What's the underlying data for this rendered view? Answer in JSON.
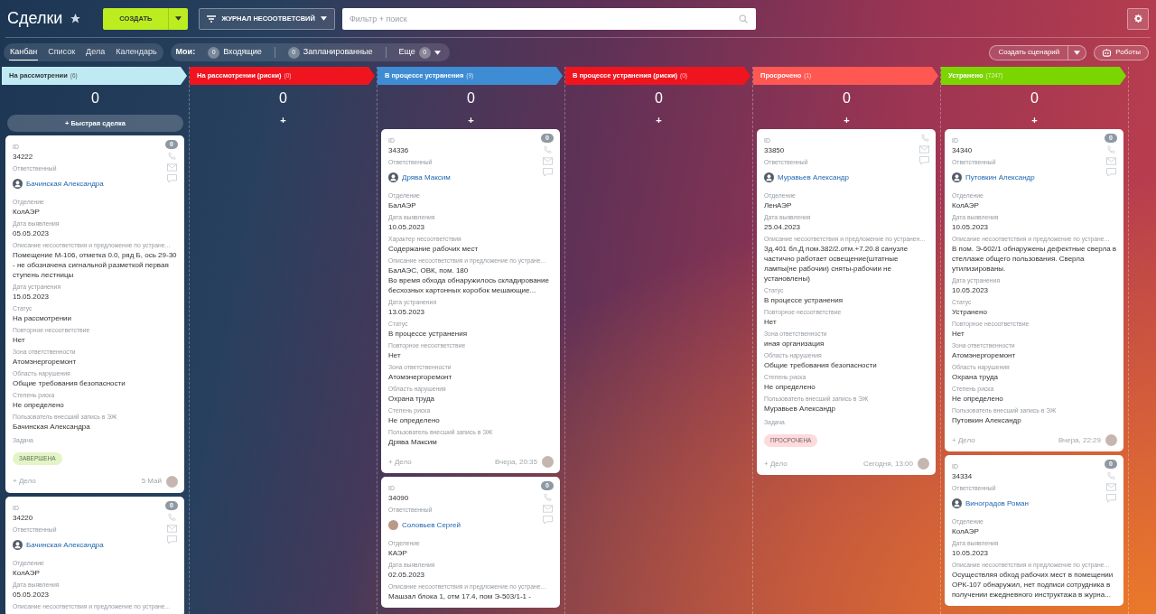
{
  "header": {
    "title": "Сделки",
    "create_button": "СОЗДАТЬ",
    "journal_button": "ЖУРНАЛ НЕСООТВЕТСВИЙ",
    "search": {
      "placeholder": "Фильтр + поиск"
    }
  },
  "view_tabs": [
    {
      "label": "Канбан",
      "selected": true
    },
    {
      "label": "Список",
      "selected": false
    },
    {
      "label": "Дела",
      "selected": false
    },
    {
      "label": "Календарь",
      "selected": false
    }
  ],
  "my_counters": {
    "label": "Мои:",
    "items": [
      {
        "label": "Входящие",
        "count": "0"
      },
      {
        "label": "Запланированные",
        "count": "0"
      }
    ],
    "more": {
      "label": "Еще",
      "count": "0"
    }
  },
  "scenario_button": "Создать сценарий",
  "robots_button": "Роботы",
  "columns": [
    {
      "name": "На рассмотрении",
      "count": "(6)",
      "color": "#bfeaf3",
      "total": "0",
      "add": {
        "icon": "+",
        "label": "Быстрая сделка"
      },
      "cards": [
        {
          "counter": "0",
          "fields": [
            {
              "kind": "text",
              "label": "ID",
              "value": "34222"
            },
            {
              "kind": "user",
              "label": "Ответственный",
              "value": "Бачинская Александра",
              "avatar": {
                "kind": "icon"
              }
            },
            {
              "kind": "text",
              "label": "Отделение",
              "value": "КолАЭР"
            },
            {
              "kind": "text",
              "label": "Дата выявления",
              "value": "05.05.2023"
            },
            {
              "kind": "text",
              "label": "Описание несоответствия и предложение по устране...",
              "value": "Помещение М-106, отметка 0.0, ряд Б, ось 29-30 - не обозначена сигнальной разметкой первая ступень лестницы"
            },
            {
              "kind": "text",
              "label": "Дата устранения",
              "value": "15.05.2023"
            },
            {
              "kind": "text",
              "label": "Статус",
              "value": "На рассмотрении"
            },
            {
              "kind": "text",
              "label": "Повторное несоответствие",
              "value": "Нет"
            },
            {
              "kind": "text",
              "label": "Зона ответственности",
              "value": "Атомэнергоремонт"
            },
            {
              "kind": "text",
              "label": "Область нарушения",
              "value": "Общие требования безопасности"
            },
            {
              "kind": "text",
              "label": "Степень риска",
              "value": "Не определено"
            },
            {
              "kind": "text",
              "label": "Пользователь внесший запись в ЭЖ",
              "value": "Бачинская Александра"
            },
            {
              "kind": "badge",
              "label": "Задача",
              "value": "ЗАВЕРШЕНА",
              "color": "#e3f5c7"
            }
          ],
          "footer": {
            "add": "+ Дело",
            "date": "5 Май"
          }
        },
        {
          "counter": "0",
          "fields": [
            {
              "kind": "text",
              "label": "ID",
              "value": "34220"
            },
            {
              "kind": "user",
              "label": "Ответственный",
              "value": "Бачинская Александра",
              "avatar": {
                "kind": "icon"
              }
            },
            {
              "kind": "text",
              "label": "Отделение",
              "value": "КолАЭР"
            },
            {
              "kind": "text",
              "label": "Дата выявления",
              "value": "05.05.2023"
            },
            {
              "kind": "text",
              "label": "Описание несоответствия и предложение по устране..."
            }
          ]
        }
      ]
    },
    {
      "name": "На рассмотрении (риски)",
      "count": "(0)",
      "color": "#f0141e",
      "total": "0",
      "add": {
        "icon": "+"
      }
    },
    {
      "name": "В процессе устранения",
      "count": "(9)",
      "color": "#3e8cd3",
      "total": "0",
      "add": {
        "icon": "+"
      },
      "cards": [
        {
          "counter": "0",
          "fields": [
            {
              "kind": "text",
              "label": "ID",
              "value": "34336"
            },
            {
              "kind": "user",
              "label": "Ответственный",
              "value": "Дрява Максим",
              "avatar": {
                "kind": "icon"
              }
            },
            {
              "kind": "text",
              "label": "Отделение",
              "value": "БалАЭР"
            },
            {
              "kind": "text",
              "label": "Дата выявления",
              "value": "10.05.2023"
            },
            {
              "kind": "text",
              "label": "Характер несоответствия",
              "value": "Содержание рабочих мест"
            },
            {
              "kind": "text",
              "label": "Описание несоответствия и предложение по устране...",
              "value": "БалАЭС, ОВК, пом. 180\nВо время обхода обнаружилось складирование бесхозных картонных коробок мешающие..."
            },
            {
              "kind": "text",
              "label": "Дата устранения",
              "value": "13.05.2023"
            },
            {
              "kind": "text",
              "label": "Статус",
              "value": "В процессе устранения"
            },
            {
              "kind": "text",
              "label": "Повторное несоответствие",
              "value": "Нет"
            },
            {
              "kind": "text",
              "label": "Зона ответственности",
              "value": "Атомэнергоремонт"
            },
            {
              "kind": "text",
              "label": "Область нарушения",
              "value": "Охрана труда"
            },
            {
              "kind": "text",
              "label": "Степень риска",
              "value": "Не определено"
            },
            {
              "kind": "text",
              "label": "Пользователь внесший запись в ЭЖ",
              "value": "Дрява Максим"
            }
          ],
          "footer": {
            "add": "+ Дело",
            "date": "Вчера, 20:35"
          }
        },
        {
          "counter": "0",
          "fields": [
            {
              "kind": "text",
              "label": "ID",
              "value": "34090"
            },
            {
              "kind": "user",
              "label": "Ответственный",
              "value": "Соловьев Сергей",
              "avatar": {
                "kind": "photo"
              }
            },
            {
              "kind": "text",
              "label": "Отделение",
              "value": "КАЭР"
            },
            {
              "kind": "text",
              "label": "Дата выявления",
              "value": "02.05.2023"
            },
            {
              "kind": "text",
              "label": "Описание несоответствия и предложение по устране...",
              "value": "Машзал блока 1, отм 17.4, пом Э-503/1-1 -"
            }
          ]
        }
      ]
    },
    {
      "name": "В процессе устранения (риски)",
      "count": "(0)",
      "color": "#f0141e",
      "total": "0",
      "add": {
        "icon": "+"
      }
    },
    {
      "name": "Просрочено",
      "count": "(1)",
      "color": "#ff5752",
      "total": "0",
      "add": {
        "icon": "+"
      },
      "cards": [
        {
          "fields": [
            {
              "kind": "text",
              "label": "ID",
              "value": "33850"
            },
            {
              "kind": "user",
              "label": "Ответственный",
              "value": "Муравьев Александр",
              "avatar": {
                "kind": "icon"
              }
            },
            {
              "kind": "text",
              "label": "Отделение",
              "value": "ЛенАЭР"
            },
            {
              "kind": "text",
              "label": "Дата выявления",
              "value": "25.04.2023"
            },
            {
              "kind": "text",
              "label": "Описание несоответствия и предложение по устранен...",
              "value": "Зд.401 бл.Д пом.382/2.отм.+7.20.8 санузле частично работает освещение(штатные лампы(не рабочии) сняты-рабочии не установлены)"
            },
            {
              "kind": "text",
              "label": "Статус",
              "value": "В процессе устранения"
            },
            {
              "kind": "text",
              "label": "Повторное несоответствие",
              "value": "Нет"
            },
            {
              "kind": "text",
              "label": "Зона ответственности",
              "value": "иная организация"
            },
            {
              "kind": "text",
              "label": "Область нарушения",
              "value": "Общие требования безопасности"
            },
            {
              "kind": "text",
              "label": "Степень риска",
              "value": "Не определено"
            },
            {
              "kind": "text",
              "label": "Пользователь внесший запись в ЭЖ",
              "value": "Муравьев Александр"
            },
            {
              "kind": "badge",
              "label": "Задача",
              "value": "ПРОСРОЧЕНА",
              "color": "#fddadb"
            }
          ],
          "footer": {
            "add": "+ Дело",
            "date": "Сегодня, 13:00"
          }
        }
      ]
    },
    {
      "name": "Устранено",
      "count": "(7247)",
      "color": "#7bd500",
      "total": "0",
      "add": {
        "icon": "+"
      },
      "cards": [
        {
          "counter": "0",
          "fields": [
            {
              "kind": "text",
              "label": "ID",
              "value": "34340"
            },
            {
              "kind": "user",
              "label": "Ответственный",
              "value": "Путовкин Александр",
              "avatar": {
                "kind": "icon"
              }
            },
            {
              "kind": "text",
              "label": "Отделение",
              "value": "КолАЭР"
            },
            {
              "kind": "text",
              "label": "Дата выявления",
              "value": "10.05.2023"
            },
            {
              "kind": "text",
              "label": "Описание несоответствия и предложение по устране...",
              "value": "В пом. Э-602/1 обнаружены дефектные сверла в стеллаже общего пользования. Сверла утилизированы."
            },
            {
              "kind": "text",
              "label": "Дата устранения",
              "value": "10.05.2023"
            },
            {
              "kind": "text",
              "label": "Статус",
              "value": "Устранено"
            },
            {
              "kind": "text",
              "label": "Повторное несоответствие",
              "value": "Нет"
            },
            {
              "kind": "text",
              "label": "Зона ответственности",
              "value": "Атомэнергоремонт"
            },
            {
              "kind": "text",
              "label": "Область нарушения",
              "value": "Охрана труда"
            },
            {
              "kind": "text",
              "label": "Степень риска",
              "value": "Не определено"
            },
            {
              "kind": "text",
              "label": "Пользователь внесший запись в ЭЖ",
              "value": "Путовкин Александр"
            }
          ],
          "footer": {
            "add": "+ Дело",
            "date": "Вчера, 22:29"
          }
        },
        {
          "counter": "0",
          "fields": [
            {
              "kind": "text",
              "label": "ID",
              "value": "34334"
            },
            {
              "kind": "user",
              "label": "Ответственный",
              "value": "Виноградов Роман",
              "avatar": {
                "kind": "icon"
              }
            },
            {
              "kind": "text",
              "label": "Отделение",
              "value": "КолАЭР"
            },
            {
              "kind": "text",
              "label": "Дата выявления",
              "value": "10.05.2023"
            },
            {
              "kind": "text",
              "label": "Описание несоответствия и предложение по устране...",
              "value": "Осуществляя обход рабочих мест в помещении ОРК-107 обнаружил, нет подписи сотрудника в получении ежедневного инструктажа в журна..."
            }
          ]
        }
      ]
    }
  ]
}
